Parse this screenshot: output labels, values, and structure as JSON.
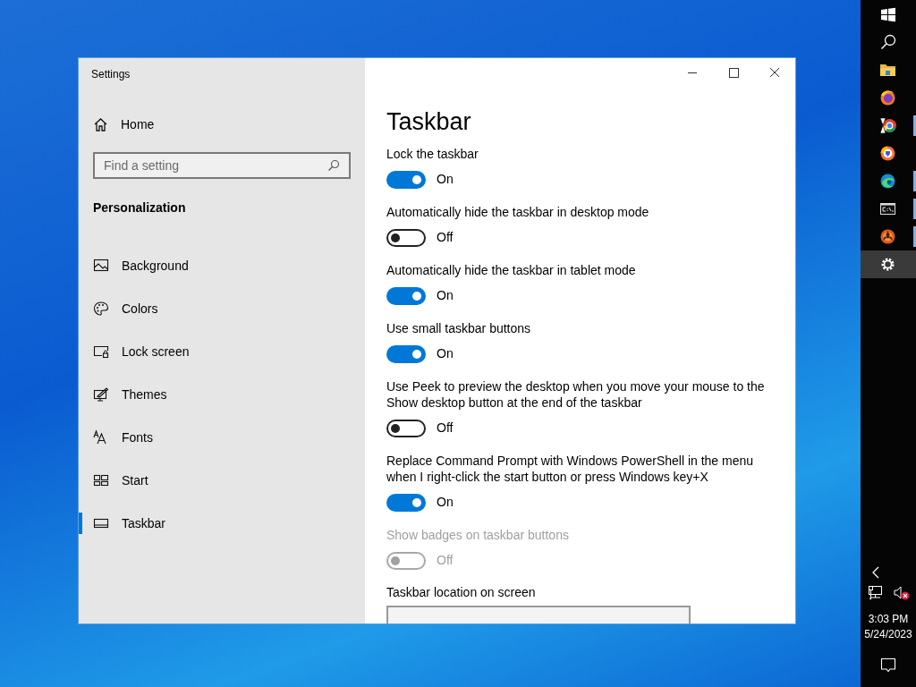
{
  "window": {
    "title": "Settings"
  },
  "sidebar": {
    "home": "Home",
    "search": {
      "placeholder": "Find a setting"
    },
    "section": "Personalization",
    "items": [
      {
        "label": "Background",
        "selected": false
      },
      {
        "label": "Colors",
        "selected": false
      },
      {
        "label": "Lock screen",
        "selected": false
      },
      {
        "label": "Themes",
        "selected": false
      },
      {
        "label": "Fonts",
        "selected": false
      },
      {
        "label": "Start",
        "selected": false
      },
      {
        "label": "Taskbar",
        "selected": true
      }
    ]
  },
  "page": {
    "title": "Taskbar",
    "settings": [
      {
        "label": "Lock the taskbar",
        "on": true,
        "disabled": false,
        "state_text": "On"
      },
      {
        "label": "Automatically hide the taskbar in desktop mode",
        "on": false,
        "disabled": false,
        "state_text": "Off"
      },
      {
        "label": "Automatically hide the taskbar in tablet mode",
        "on": true,
        "disabled": false,
        "state_text": "On"
      },
      {
        "label": "Use small taskbar buttons",
        "on": true,
        "disabled": false,
        "state_text": "On"
      },
      {
        "label": "Use Peek to preview the desktop when you move your mouse to the Show desktop button at the end of the taskbar",
        "on": false,
        "disabled": false,
        "state_text": "Off"
      },
      {
        "label": "Replace Command Prompt with Windows PowerShell in the menu when I right-click the start button or press Windows key+X",
        "on": true,
        "disabled": false,
        "state_text": "On"
      },
      {
        "label": "Show badges on taskbar buttons",
        "on": false,
        "disabled": true,
        "state_text": "Off"
      }
    ],
    "location_label": "Taskbar location on screen"
  },
  "taskbar": {
    "items": [
      {
        "kind": "start",
        "running": false,
        "active": false
      },
      {
        "kind": "search",
        "running": false,
        "active": false
      },
      {
        "kind": "folder",
        "running": false,
        "active": false
      },
      {
        "kind": "browser-orange",
        "running": false,
        "active": false
      },
      {
        "kind": "browser-busy",
        "running": true,
        "active": false
      },
      {
        "kind": "browser-orange-shield",
        "running": false,
        "active": false
      },
      {
        "kind": "browser-wave",
        "running": true,
        "active": false
      },
      {
        "kind": "console",
        "running": true,
        "active": false
      },
      {
        "kind": "hazard",
        "running": true,
        "active": false
      },
      {
        "kind": "gear",
        "running": false,
        "active": true
      }
    ],
    "time": "3:03 PM",
    "date": "5/24/2023"
  }
}
